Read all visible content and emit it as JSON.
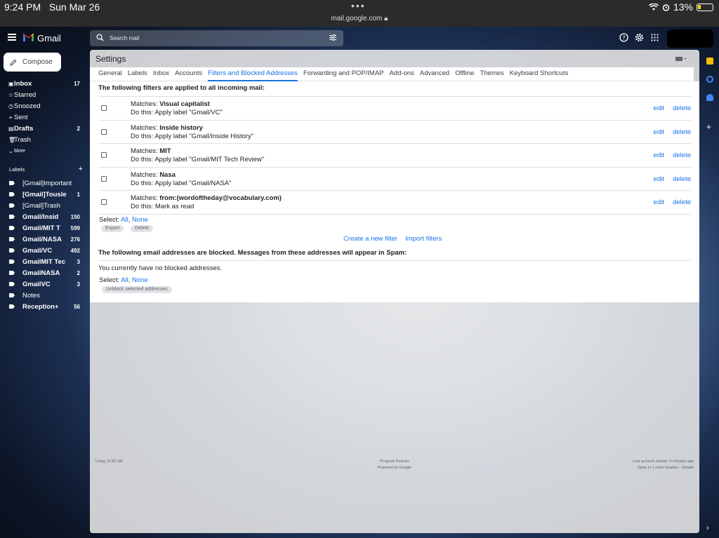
{
  "status_bar": {
    "time": "9:24 PM",
    "date": "Sun Mar 26",
    "battery": "13%",
    "url": "mail.google.com"
  },
  "app": {
    "name": "Gmail",
    "compose_label": "Compose"
  },
  "search": {
    "placeholder": "Search mail"
  },
  "nav": {
    "items": [
      {
        "label": "Inbox",
        "count": "17",
        "bold": true,
        "icon": "inbox-icon"
      },
      {
        "label": "Starred",
        "count": "",
        "bold": false,
        "icon": "star-icon"
      },
      {
        "label": "Snoozed",
        "count": "",
        "bold": false,
        "icon": "clock-icon"
      },
      {
        "label": "Sent",
        "count": "",
        "bold": false,
        "icon": "send-icon"
      },
      {
        "label": "Drafts",
        "count": "2",
        "bold": true,
        "icon": "draft-icon"
      },
      {
        "label": "Trash",
        "count": "",
        "bold": false,
        "icon": "trash-icon"
      },
      {
        "label": "More",
        "count": "",
        "bold": false,
        "icon": "chevron-down-icon"
      }
    ],
    "labels_heading": "Labels",
    "labels": [
      {
        "label": "[Gmail]Important",
        "count": "",
        "bold": false
      },
      {
        "label": "[Gmail]Tousle",
        "count": "1",
        "bold": true
      },
      {
        "label": "[Gmail]Trash",
        "count": "",
        "bold": false
      },
      {
        "label": "Gmail/Insid",
        "count": "150",
        "bold": true
      },
      {
        "label": "Gmail/MIT T",
        "count": "599",
        "bold": true
      },
      {
        "label": "Gmail/NASA",
        "count": "276",
        "bold": true
      },
      {
        "label": "Gmail/VC",
        "count": "492",
        "bold": true
      },
      {
        "label": "GmailMIT Tec",
        "count": "3",
        "bold": true
      },
      {
        "label": "GmailNASA",
        "count": "2",
        "bold": true
      },
      {
        "label": "GmailVC",
        "count": "3",
        "bold": true
      },
      {
        "label": "Notes",
        "count": "",
        "bold": false
      },
      {
        "label": "Reception+",
        "count": "56",
        "bold": true
      }
    ]
  },
  "settings": {
    "title": "Settings",
    "tabs": [
      {
        "label": "General",
        "active": false
      },
      {
        "label": "Labels",
        "active": false
      },
      {
        "label": "Inbox",
        "active": false
      },
      {
        "label": "Accounts",
        "active": false
      },
      {
        "label": "Filters and Blocked Addresses",
        "active": true
      },
      {
        "label": "Forwarding and POP/IMAP",
        "active": false
      },
      {
        "label": "Add-ons",
        "active": false
      },
      {
        "label": "Advanced",
        "active": false
      },
      {
        "label": "Offline",
        "active": false
      },
      {
        "label": "Themes",
        "active": false
      },
      {
        "label": "Keyboard Shortcuts",
        "active": false
      }
    ],
    "filters_heading": "The following filters are applied to all incoming mail:",
    "filters": [
      {
        "match_prefix": "Matches: ",
        "match": "Visual capitalist",
        "action": "Do this: Apply label \"Gmail/VC\""
      },
      {
        "match_prefix": "Matches: ",
        "match": "Inside history",
        "action": "Do this: Apply label \"Gmail/Inside History\""
      },
      {
        "match_prefix": "Matches: ",
        "match": "MIT",
        "action": "Do this: Apply label \"Gmail/MIT Tech Review\""
      },
      {
        "match_prefix": "Matches: ",
        "match": "Nasa",
        "action": "Do this: Apply label \"Gmail/NASA\""
      },
      {
        "match_prefix": "Matches: ",
        "match": "from:(wordoftheday@vocabulary.com)",
        "action": "Do this: Mark as read"
      }
    ],
    "edit_label": "edit",
    "delete_label": "delete",
    "select_prefix": "Select: ",
    "select_all": "All",
    "select_sep": ", ",
    "select_none": "None",
    "export_label": "Export",
    "delete_button_label": "Delete",
    "create_filter": "Create a new filter",
    "import_filters": "Import filters",
    "blocked_heading": "The following email addresses are blocked. Messages from these addresses will appear in Spam:",
    "no_blocked": "You currently have no blocked addresses.",
    "unblock_label": "Unblock selected addresses"
  },
  "footer": {
    "storage": "Using 12.83 GB",
    "policies": "Program Policies",
    "powered": "Powered by Google",
    "activity": "Last account activity: 0 minutes ago",
    "details": "Open in 1 other location · Details"
  }
}
